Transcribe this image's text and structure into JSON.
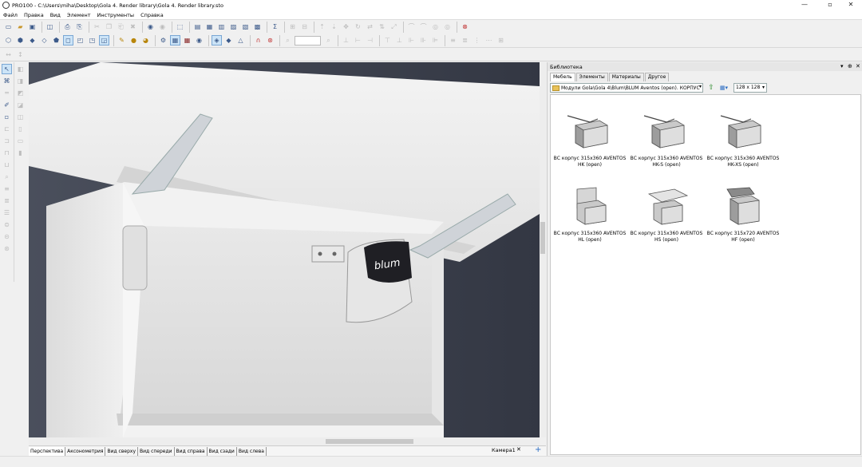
{
  "window": {
    "title": "PRO100 - C:\\Users\\miha\\Desktop\\Gola 4. Render library\\Gola 4. Render library.sto",
    "minimize_glyph": "—",
    "maximize_glyph": "▫",
    "close_glyph": "✕"
  },
  "menu": [
    "Файл",
    "Правка",
    "Вид",
    "Элемент",
    "Инструменты",
    "Справка"
  ],
  "view_tabs": [
    "Перспектива",
    "Аксонометрия",
    "Вид сверху",
    "Вид спереди",
    "Вид справа",
    "Вид сзади",
    "Вид слева"
  ],
  "active_view_tab": 0,
  "camera_tab": "Камера1",
  "camera_close": "✕",
  "add_view": "+",
  "panel": {
    "title": "Библиотека",
    "pin_glyph": "⊕",
    "close_glyph": "✕",
    "menu_glyph": "▾",
    "tabs": [
      "Мебель",
      "Элементы",
      "Материалы",
      "Другое"
    ],
    "active_tab": 0,
    "path": "Модули Gola\\Gola 4\\Blum\\BLUM Aventos (open). КОРПУС",
    "path_dropdown": "▾",
    "up_glyph": "⇧",
    "view_glyph": "▦▾",
    "thumb_size": "128 x 128",
    "thumb_size_dropdown": "▾",
    "items": [
      {
        "label": "ВС корпус 315x360 AVENTOS HK (open)",
        "variant": "hk"
      },
      {
        "label": "ВС корпус 315x360 AVENTOS HK-S (open)",
        "variant": "hk"
      },
      {
        "label": "ВС корпус 315x360 AVENTOS HK-XS (open)",
        "variant": "hk"
      },
      {
        "label": "ВС корпус 315x360 AVENTOS HL (open)",
        "variant": "hl"
      },
      {
        "label": "ВС корпус 315x360 AVENTOS HS (open)",
        "variant": "hs"
      },
      {
        "label": "ВС корпус 315x720 AVENTOS HF (open)",
        "variant": "hf"
      }
    ]
  },
  "viewport": {
    "brand_logo": "blum",
    "bg_color": "#3d4250",
    "cabinet_color": "#e9e9e9"
  },
  "toolbar1_icons": [
    "new-icon",
    "open-icon",
    "save-icon",
    "preview-icon",
    "print-icon",
    "print-setup-icon",
    "cut-icon",
    "copy-icon",
    "paste-icon",
    "delete-icon",
    "undo-icon",
    "redo-icon",
    "export-icon",
    "select-all-icon",
    "group-icon",
    "ungroup-icon",
    "lock-icon",
    "unlock-icon",
    "hide-icon",
    "sum-icon"
  ],
  "toolbar2_icons": [
    "cube-icon",
    "cube-front-icon",
    "cube-back-icon",
    "cube-side-icon",
    "box-icon",
    "box-open-icon",
    "box-right-icon",
    "box-left-icon",
    "material-icon",
    "lights-icon",
    "render-icon",
    "wireframe-icon",
    "texture-icon",
    "grid-icon",
    "eye-icon",
    "snap-icon",
    "snap-grid-icon",
    "measure-icon",
    "magnet-icon",
    "stop-icon",
    "zoom-icon"
  ]
}
